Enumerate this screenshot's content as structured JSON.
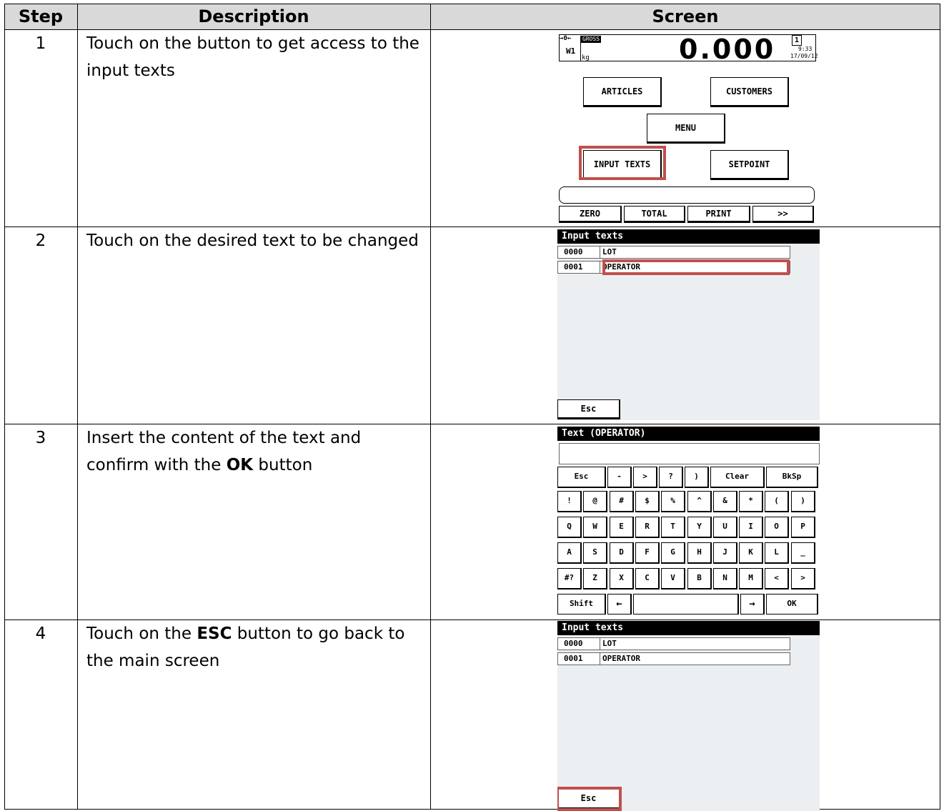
{
  "headers": {
    "step": "Step",
    "description": "Description",
    "screen": "Screen"
  },
  "steps": [
    {
      "number": "1",
      "text": "Touch on the button to get access to the input texts"
    },
    {
      "number": "2",
      "text": "Touch on the desired text to be changed"
    },
    {
      "number": "3",
      "text_before": "Insert the content of the text and confirm with the ",
      "bold": "OK",
      "text_after": " button"
    },
    {
      "number": "4",
      "text_before": "Touch on the ",
      "bold": "ESC",
      "text_after": " button to go back to the main screen"
    }
  ],
  "screen1": {
    "zero_symbol": "→0←",
    "scale": "W1",
    "gross_label": "GROSS",
    "weight": "0.000",
    "unit": "kg",
    "channel": "1",
    "time": "9:33",
    "date": "17/09/12",
    "buttons": {
      "articles": "ARTICLES",
      "customers": "CUSTOMERS",
      "menu": "MENU",
      "input_texts": "INPUT TEXTS",
      "setpoint": "SETPOINT"
    },
    "bottom": {
      "zero": "ZERO",
      "total": "TOTAL",
      "print": "PRINT",
      "more": ">>"
    }
  },
  "screen2": {
    "title": "Input texts",
    "items": [
      {
        "code": "0000",
        "name": "LOT"
      },
      {
        "code": "0001",
        "name": "OPERATOR"
      }
    ],
    "esc": "Esc"
  },
  "screen3": {
    "title": "Text (OPERATOR)",
    "top_keys": [
      "Esc",
      "-",
      ">",
      "?",
      ")",
      "Clear",
      "BkSp"
    ],
    "row1": [
      "!",
      "@",
      "#",
      "$",
      "%",
      "^",
      "&",
      "*",
      "(",
      ")"
    ],
    "row2": [
      "Q",
      "W",
      "E",
      "R",
      "T",
      "Y",
      "U",
      "I",
      "O",
      "P"
    ],
    "row3": [
      "A",
      "S",
      "D",
      "F",
      "G",
      "H",
      "J",
      "K",
      "L",
      "_"
    ],
    "row4": [
      "#?",
      "Z",
      "X",
      "C",
      "V",
      "B",
      "N",
      "M",
      "<",
      ">"
    ],
    "bottom_keys": {
      "shift": "Shift",
      "left": "←",
      "right": "→",
      "ok": "OK"
    }
  },
  "screen4": {
    "title": "Input texts",
    "items": [
      {
        "code": "0000",
        "name": "LOT"
      },
      {
        "code": "0001",
        "name": "OPERATOR"
      }
    ],
    "esc": "Esc"
  },
  "colors": {
    "header_bg": "#d9d9d9",
    "highlight": "#c0504d"
  }
}
